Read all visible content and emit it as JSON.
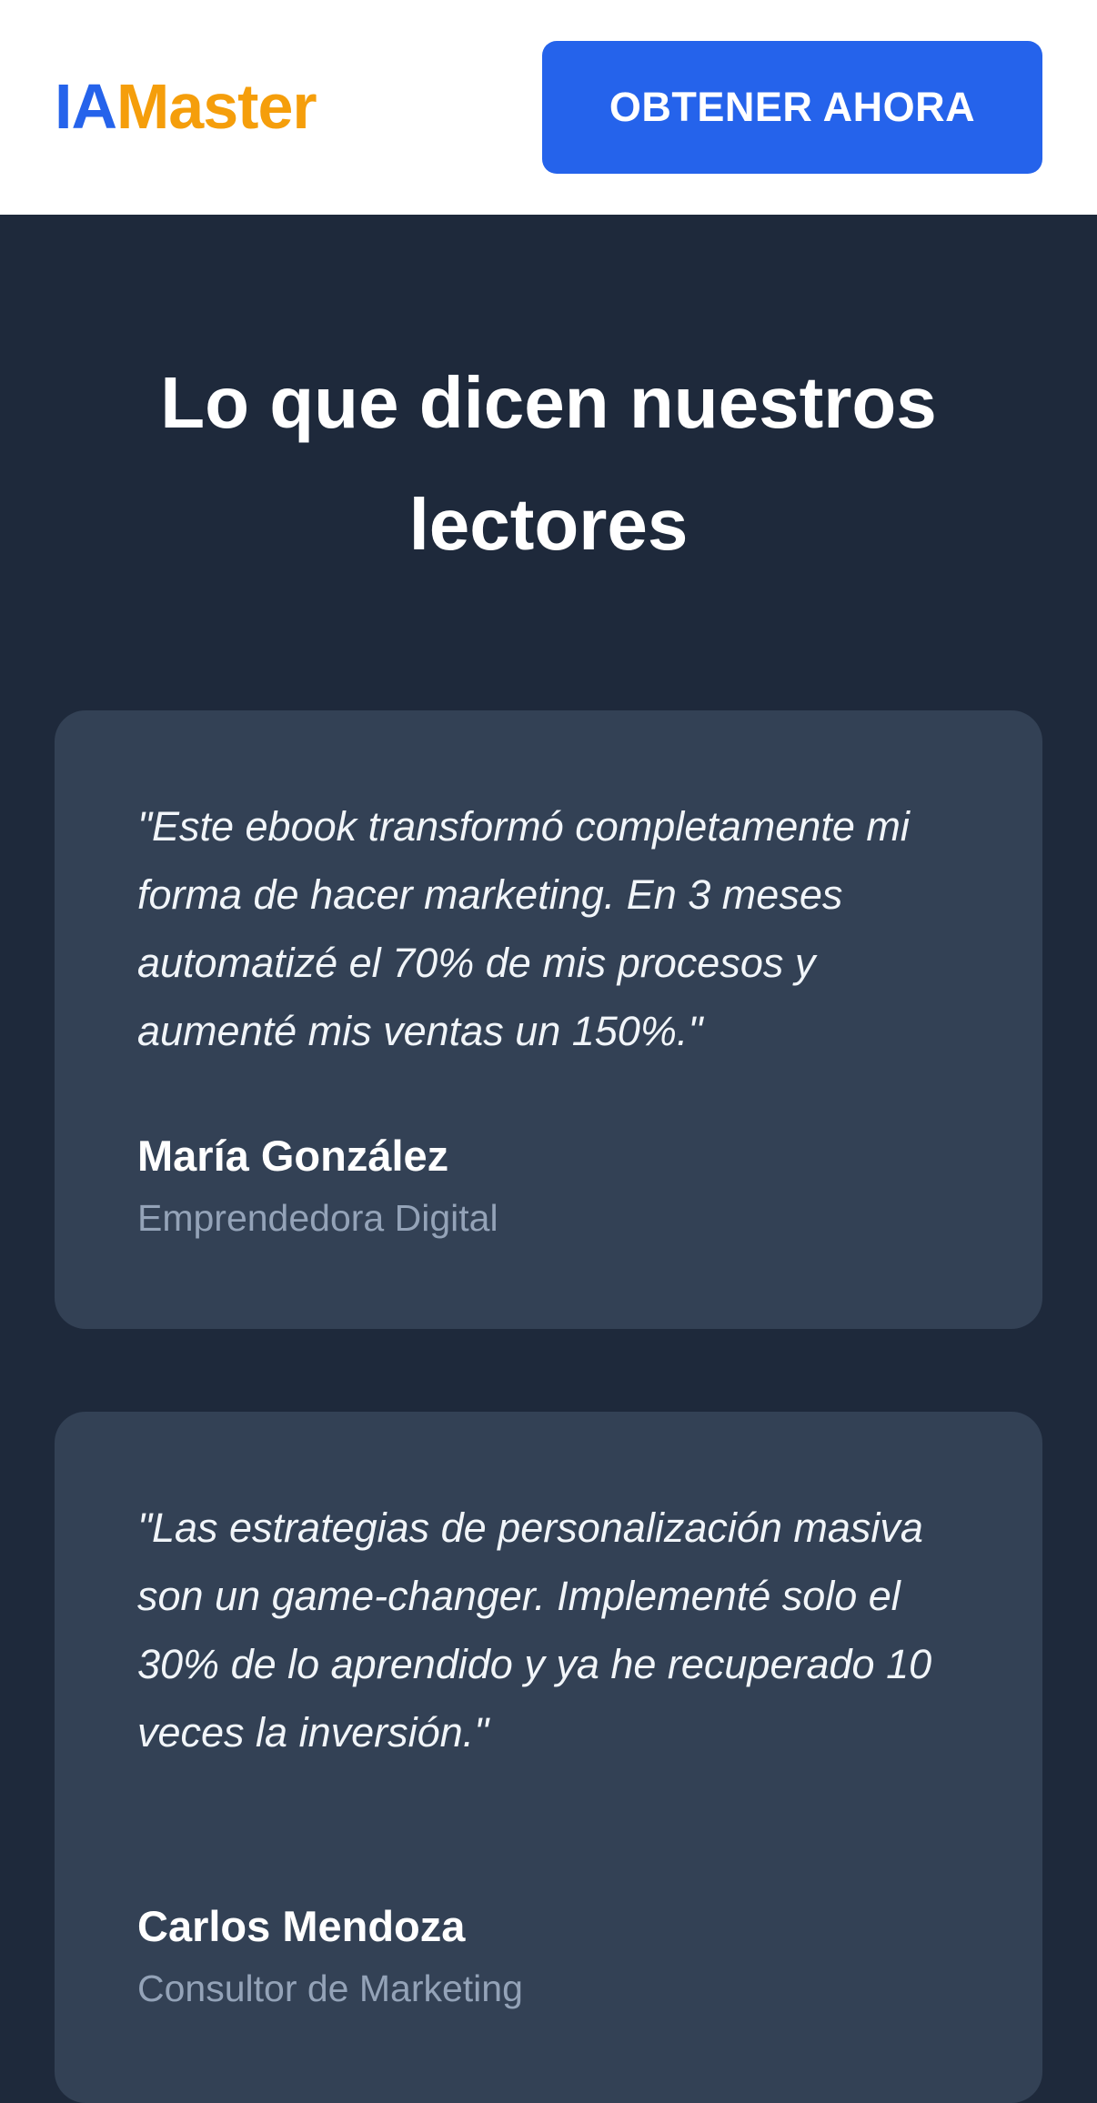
{
  "header": {
    "logo_ia": "IA",
    "logo_master": "Master",
    "cta_label": "OBTENER AHORA"
  },
  "testimonials_section": {
    "title": "Lo que dicen nuestros lectores",
    "items": [
      {
        "quote": "\"Este ebook transformó completamente mi forma de hacer marketing. En 3 meses automatizé el 70% de mis procesos y aumenté mis ventas un 150%.\"",
        "author": "María González",
        "role": "Emprendedora Digital"
      },
      {
        "quote": "\"Las estrategias de personalización masiva son un game-changer. Implementé solo el 30% de lo aprendido y ya he recuperado 10 veces la inversión.\"",
        "author": "Carlos Mendoza",
        "role": "Consultor de Marketing"
      }
    ]
  },
  "colors": {
    "brand_blue": "#2563eb",
    "brand_orange": "#f59e0b",
    "section_bg": "#1e293b",
    "card_bg": "#334155",
    "muted_text": "#94a3b8"
  }
}
